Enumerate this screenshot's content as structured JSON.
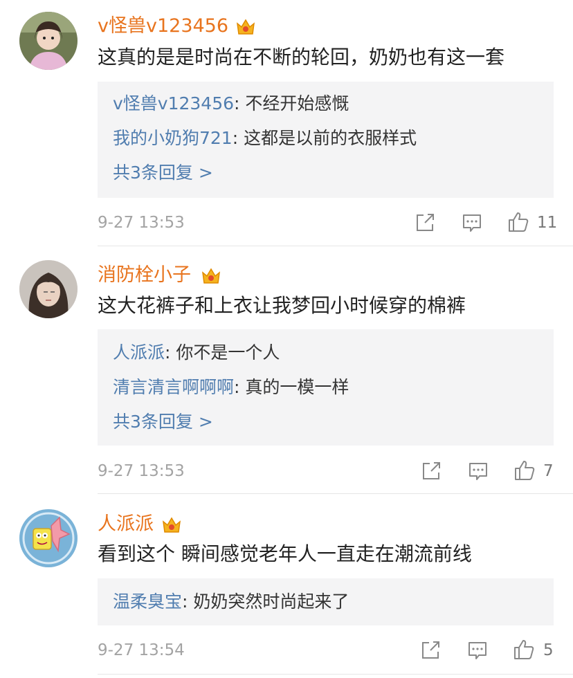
{
  "comments": [
    {
      "username": "v怪兽v123456",
      "text": "这真的是是时尚在不断的轮回，奶奶也有这一套",
      "replies": [
        {
          "user": "v怪兽v123456",
          "sep": ": ",
          "text": "不经开始感慨"
        },
        {
          "user": "我的小奶狗721",
          "sep": ": ",
          "text": "这都是以前的衣服样式"
        }
      ],
      "more_replies": "共3条回复 >",
      "timestamp": "9-27 13:53",
      "likes": "11"
    },
    {
      "username": "消防栓小子",
      "text": "这大花裤子和上衣让我梦回小时候穿的棉裤",
      "replies": [
        {
          "user": "人派派",
          "sep": ": ",
          "text": "你不是一个人"
        },
        {
          "user": "清言清言啊啊啊",
          "sep": ": ",
          "text": "真的一模一样"
        }
      ],
      "more_replies": "共3条回复 >",
      "timestamp": "9-27 13:53",
      "likes": "7"
    },
    {
      "username": "人派派",
      "text": "看到这个 瞬间感觉老年人一直走在潮流前线",
      "replies": [
        {
          "user": "温柔臭宝",
          "sep": ": ",
          "text": "奶奶突然时尚起来了"
        }
      ],
      "timestamp": "9-27 13:54",
      "likes": "5"
    }
  ],
  "colors": {
    "username": "#e8741e",
    "reply_user": "#507daf",
    "timestamp": "#a3a3a3",
    "reply_bg": "#f4f4f5"
  },
  "icons": {
    "vip": "vip-crown-badge-icon",
    "share": "share-icon",
    "comment": "comment-icon",
    "like": "thumbs-up-icon"
  }
}
